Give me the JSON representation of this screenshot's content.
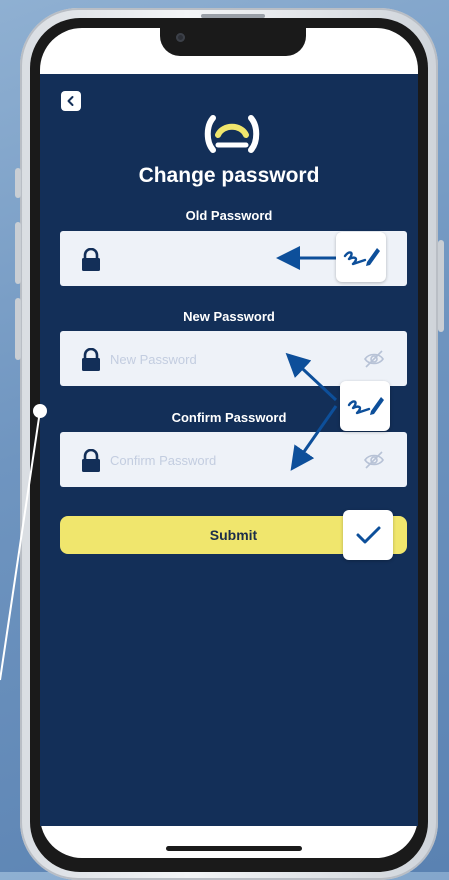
{
  "screen": {
    "title": "Change password",
    "back_icon": "chevron-left-icon",
    "logo_icon": "brand-logo-icon"
  },
  "form": {
    "old_password": {
      "label": "Old Password",
      "placeholder": "",
      "value": ""
    },
    "new_password": {
      "label": "New Password",
      "placeholder": "New Password",
      "value": ""
    },
    "confirm_password": {
      "label": "Confirm Password",
      "placeholder": "Confirm Password",
      "value": ""
    },
    "submit_label": "Submit"
  },
  "colors": {
    "background": "#132f58",
    "field": "#eef2f8",
    "accent": "#f0e66d",
    "annotation": "#0d4f9a"
  },
  "annotations": {
    "icons": [
      "pen-signature-icon",
      "pen-signature-icon",
      "checkmark-icon",
      "arrow-icon"
    ]
  }
}
